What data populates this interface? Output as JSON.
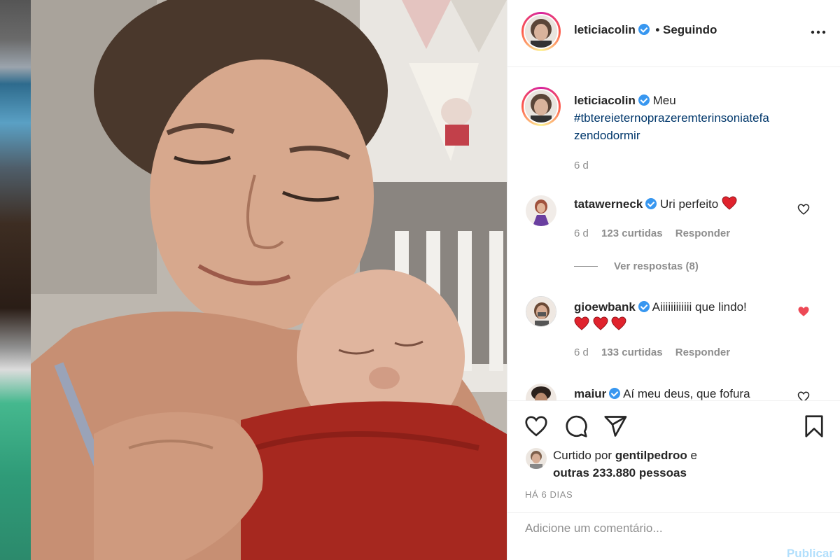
{
  "post": {
    "author": "leticiacolin",
    "follow_status": "• Seguindo",
    "more_icon": "ellipsis-icon"
  },
  "caption": {
    "author": "leticiacolin",
    "text": "Meu",
    "hashtag_line1": "#tbtereieternoprazeremterinsoniatefa",
    "hashtag_line2": "zendodormir",
    "time": "6 d"
  },
  "comments": [
    {
      "author": "tatawerneck",
      "text": "Uri perfeito",
      "emoji": "red-heart",
      "time": "6 d",
      "likes": "123 curtidas",
      "reply": "Responder",
      "liked": false,
      "view_replies": "Ver respostas (8)"
    },
    {
      "author": "gioewbank",
      "text": "Aiiiiiiiiiiii que lindo!",
      "emoji": "red-heart x3",
      "time": "6 d",
      "likes": "133 curtidas",
      "reply": "Responder",
      "liked": true
    },
    {
      "author": "maiur",
      "text": "Aí meu deus, que fofura",
      "liked": false
    }
  ],
  "actions": {
    "like_icon": "heart-outline-icon",
    "comment_icon": "comment-icon",
    "share_icon": "paper-plane-icon",
    "save_icon": "bookmark-icon"
  },
  "likes": {
    "prefix": "Curtido por",
    "user": "gentilpedroo",
    "suffix": "e",
    "others": "outras 233.880 pessoas"
  },
  "timestamp": "HÁ 6 DIAS",
  "comment_box": {
    "placeholder": "Adicione um comentário...",
    "publish": "Publicar"
  },
  "colors": {
    "verified": "#3897f0",
    "hashtag": "#00376b",
    "liked_heart": "#ed4956",
    "publish_disabled": "#b2dffc"
  }
}
